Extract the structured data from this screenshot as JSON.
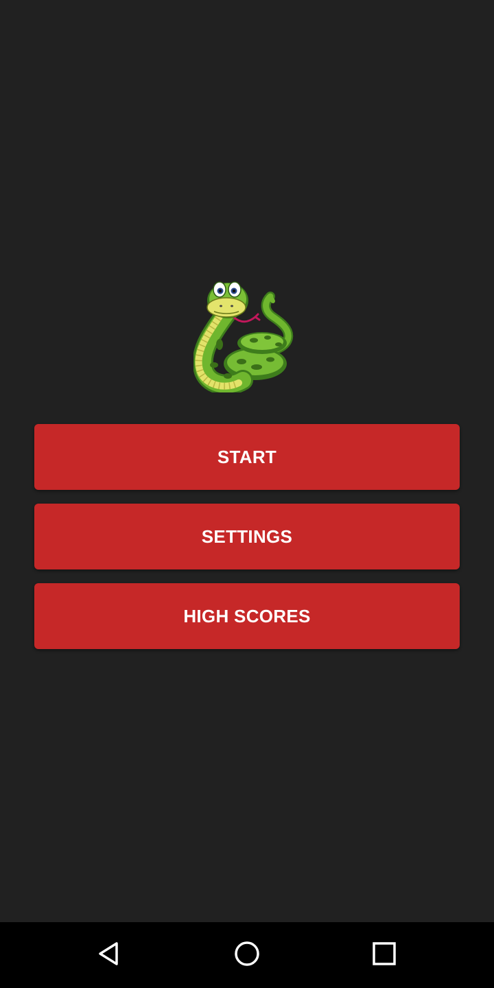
{
  "app": {
    "logo": "snake-mascot-logo"
  },
  "menu": {
    "start_label": "START",
    "settings_label": "SETTINGS",
    "high_scores_label": "HIGH SCORES"
  },
  "navigation_bar": {
    "back": "back-icon",
    "home": "home-icon",
    "recents": "recents-icon"
  },
  "colors": {
    "background": "#212121",
    "button": "#c62828",
    "button_text": "#ffffff",
    "nav_bar": "#000000"
  }
}
